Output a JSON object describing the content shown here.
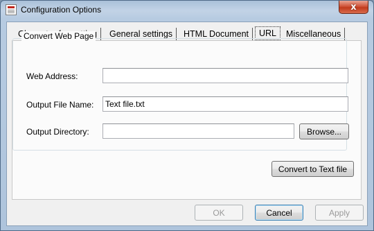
{
  "window": {
    "title": "Configuration Options",
    "close_glyph": "x",
    "icon": "document-app-icon"
  },
  "tabs": [
    {
      "label": "Character formatting",
      "active": false
    },
    {
      "label": "General settings",
      "active": false
    },
    {
      "label": "HTML Document",
      "active": false
    },
    {
      "label": "URL",
      "active": true
    },
    {
      "label": "Miscellaneous",
      "active": false
    }
  ],
  "url_tab": {
    "group_title": "Convert Web Page",
    "web_address": {
      "label": "Web Address:",
      "value": ""
    },
    "output_file_name": {
      "label": "Output File Name:",
      "value": "Text file.txt"
    },
    "output_directory": {
      "label": "Output Directory:",
      "value": ""
    },
    "browse_label": "Browse...",
    "convert_label": "Convert to Text file"
  },
  "footer": {
    "ok_label": "OK",
    "cancel_label": "Cancel",
    "apply_label": "Apply"
  }
}
